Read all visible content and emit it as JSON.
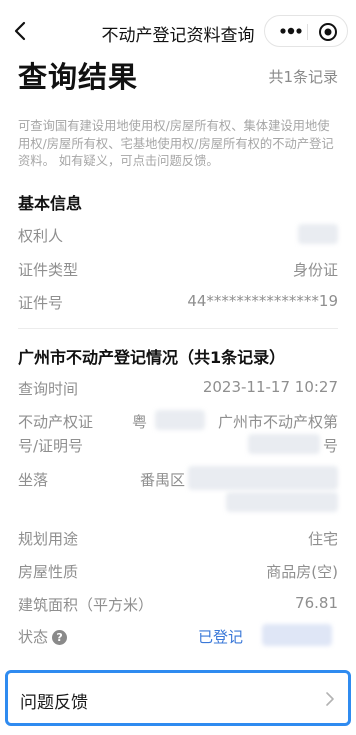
{
  "nav": {
    "title": "不动产登记资料查询",
    "back_icon": "chevron-left-icon",
    "more_icon": "more-dots-icon",
    "close_icon": "target-circle-icon"
  },
  "header": {
    "title": "查询结果",
    "record_count": "共1条记录"
  },
  "notice": "可查询国有建设用地使用权/房屋所有权、集体建设用地使用权/房屋所有权、宅基地使用权/房屋所有权的不动产登记资料。 如有疑义，可点击问题反馈。",
  "basic_info": {
    "heading": "基本信息",
    "rows": [
      {
        "label": "权利人",
        "value": ""
      },
      {
        "label": "证件类型",
        "value": "身份证"
      },
      {
        "label": "证件号",
        "value": "44***************19"
      }
    ]
  },
  "registration": {
    "heading": "广州市不动产登记情况（共1条记录）",
    "query_time_label": "查询时间",
    "query_time_value": "2023-11-17 10:27",
    "cert_label_line1": "不动产权证",
    "cert_label_line2": "号/证明号",
    "cert_value_prefix": "粤",
    "cert_value_line1": "广州市不动产权第",
    "cert_value_suffix": "号",
    "location_label": "坐落",
    "location_value": "番禺区",
    "usage_label": "规划用途",
    "usage_value": "住宅",
    "nature_label": "房屋性质",
    "nature_value": "商品房(空)",
    "area_label": "建筑面积（平方米）",
    "area_value": "76.81",
    "status_label": "状态",
    "status_help": "?",
    "status_value": "已登记"
  },
  "feedback": {
    "label": "问题反馈",
    "arrow_icon": "chevron-right-icon"
  },
  "colors": {
    "accent_blue": "#3a78d8",
    "highlight_border": "#2f8bf0",
    "muted_text": "#8f8f8f"
  }
}
